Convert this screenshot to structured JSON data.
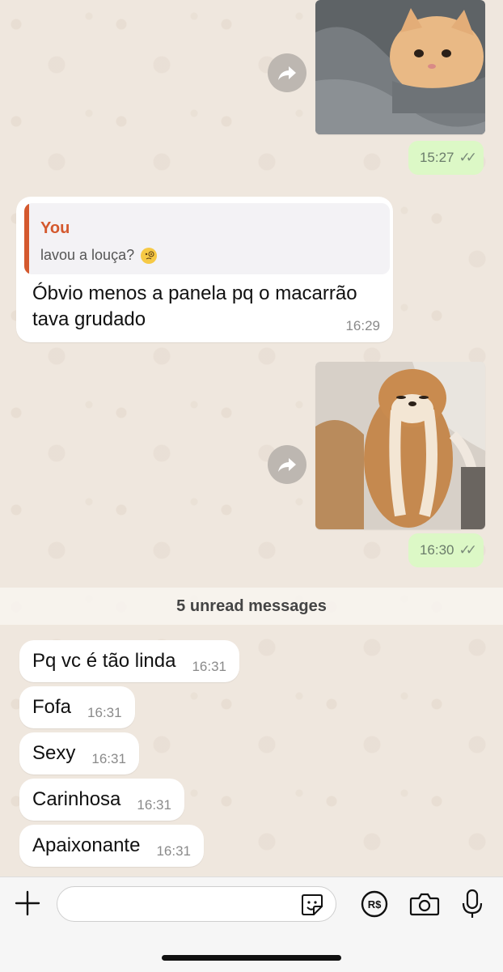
{
  "chat": {
    "sent_image_1": {
      "time": "15:27",
      "description": "cat wrapped in grey blanket"
    },
    "reply": {
      "quoted_author": "You",
      "quoted_text": "lavou a louça?",
      "quoted_emoji": "face-with-monocle-icon",
      "text": "Óbvio menos a panela pq o macarrão tava grudado",
      "time": "16:29"
    },
    "sent_image_2": {
      "time": "16:30",
      "description": "shiba puppy sleeping on back"
    },
    "unread_label": "5 unread messages",
    "incoming": [
      {
        "text": "Pq vc é tão linda",
        "time": "16:31"
      },
      {
        "text": "Fofa",
        "time": "16:31"
      },
      {
        "text": "Sexy",
        "time": "16:31"
      },
      {
        "text": "Carinhosa",
        "time": "16:31"
      },
      {
        "text": "Apaixonante",
        "time": "16:31"
      }
    ]
  },
  "composer": {
    "input_value": "",
    "icons": [
      "plus-icon",
      "sticker-icon",
      "payment-icon",
      "camera-icon",
      "microphone-icon"
    ]
  },
  "colors": {
    "outgoing_bubble": "#dcf8c6",
    "reply_accent": "#d4592e",
    "wallpaper": "#efe7de"
  }
}
